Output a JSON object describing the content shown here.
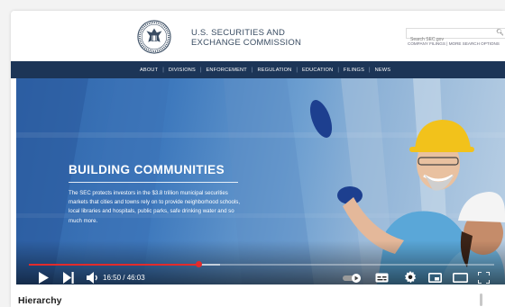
{
  "header": {
    "org_line1": "U.S. SECURITIES AND",
    "org_line2": "EXCHANGE COMMISSION",
    "search_placeholder": "Search SEC.gov",
    "link_filings": "COMPANY FILINGS",
    "link_separator": " | ",
    "link_more": "MORE SEARCH OPTIONS"
  },
  "nav": {
    "items": [
      "ABOUT",
      "DIVISIONS",
      "ENFORCEMENT",
      "REGULATION",
      "EDUCATION",
      "FILINGS",
      "NEWS"
    ],
    "separator": "|"
  },
  "hero": {
    "headline": "BUILDING COMMUNITIES",
    "body": "The SEC protects investors in the $3.8 trillion municipal securities markets that cities and towns rely on to provide neighborhood schools, local libraries and hospitals, public parks, safe drinking water and so much more."
  },
  "player": {
    "time": "16:50 / 46:03",
    "progress_fraction": 0.366,
    "buffer_fraction": 0.41
  },
  "below": {
    "heading": "Hierarchy"
  },
  "colors": {
    "nav_bg": "#1c3557",
    "progress_red": "#e32b2b",
    "hard_hat_yellow": "#f2c21b"
  }
}
